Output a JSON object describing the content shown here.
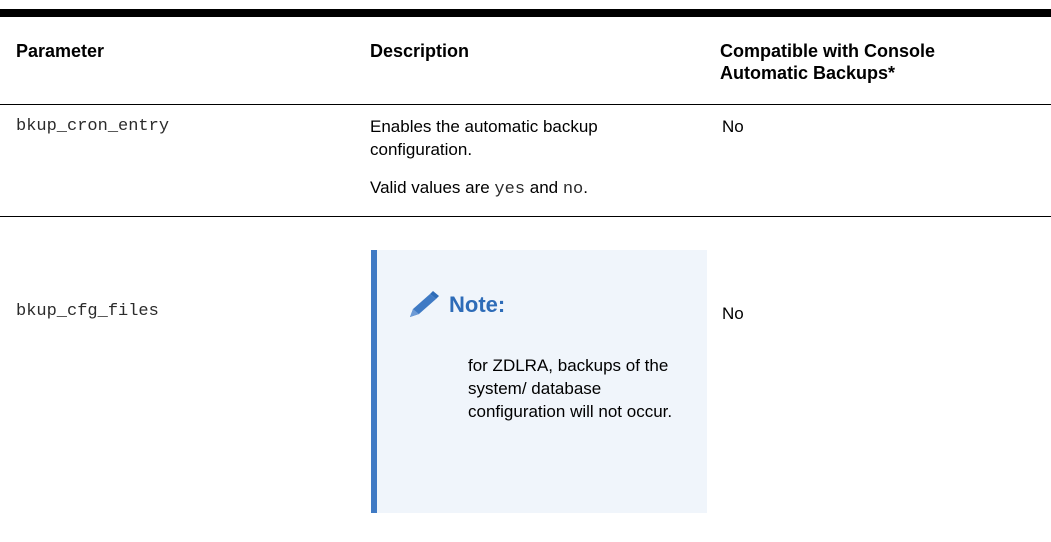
{
  "table": {
    "headers": {
      "parameter": "Parameter",
      "description": "Description",
      "compatible": "Compatible with Console Automatic Backups*"
    },
    "rows": [
      {
        "parameter": "bkup_cron_entry",
        "description": "Enables the automatic backup configuration.",
        "valid_prefix": "Valid values are ",
        "valid_yes": "yes",
        "valid_and": " and ",
        "valid_no": "no",
        "valid_suffix": ".",
        "compatible": "No"
      },
      {
        "parameter": "bkup_cfg_files",
        "note": {
          "title": "Note:",
          "body": "for ZDLRA, backups of the system/ database configuration will not occur."
        },
        "compatible": "No"
      }
    ]
  },
  "colors": {
    "note_accent": "#3f7ac4",
    "note_background": "#f0f5fb",
    "note_title": "#2e6cb8"
  },
  "icons": {
    "note": "pencil-icon"
  }
}
